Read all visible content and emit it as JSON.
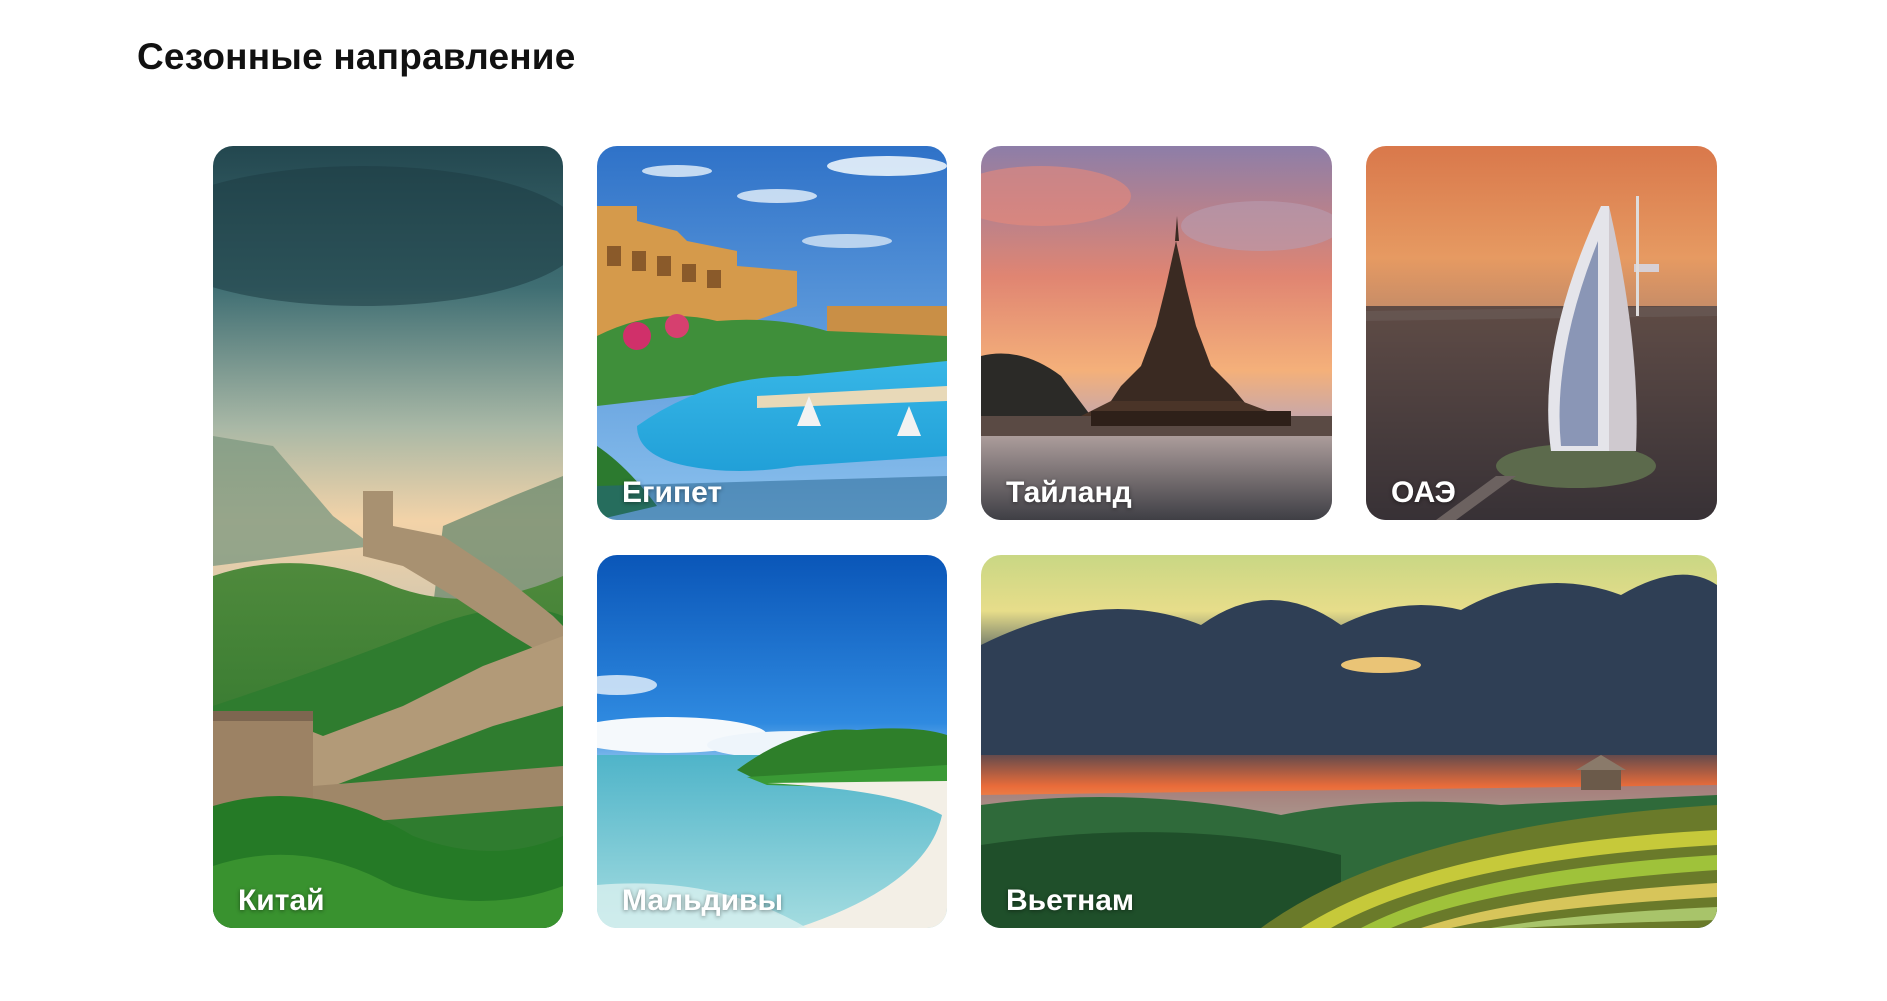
{
  "section": {
    "title": "Сезонные направление"
  },
  "destinations": [
    {
      "name": "Китай"
    },
    {
      "name": "Египет"
    },
    {
      "name": "Тайланд"
    },
    {
      "name": "ОАЭ"
    },
    {
      "name": "Мальдивы"
    },
    {
      "name": "Вьетнам"
    }
  ],
  "colors": {
    "title": "#111111",
    "label": "#ffffff",
    "background": "#ffffff"
  }
}
